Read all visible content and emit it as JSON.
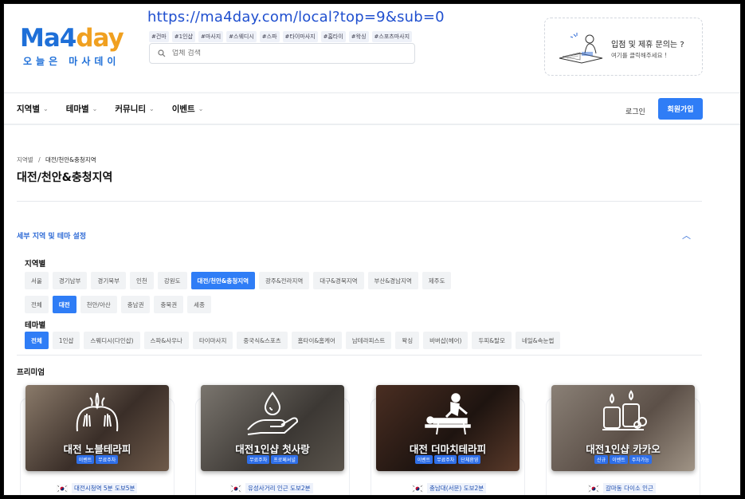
{
  "browser": {
    "url": "https://ma4day.com/local?top=9&sub=0"
  },
  "logo": {
    "main_part1": "Ma4",
    "main_part2": "day",
    "sub": "오늘은 마사데이"
  },
  "header": {
    "tags": [
      "#건마",
      "#1인샵",
      "#마사지",
      "#스웨디시",
      "#스파",
      "#타이마사지",
      "#홈타이",
      "#왁싱",
      "#스포츠마사지"
    ],
    "search_placeholder": "업체 검색"
  },
  "ad": {
    "title": "입점 및 제휴 문의는 ?",
    "subtitle": "여기를 클릭해주세요 !"
  },
  "nav": {
    "items": [
      "지역별",
      "테마별",
      "커뮤니티",
      "이벤트"
    ],
    "login": "로그인",
    "signup": "회원가입"
  },
  "breadcrumb": {
    "root": "지역별",
    "separator": "/",
    "current": "대전/천안&충청지역"
  },
  "page_title": "대전/천안&충청지역",
  "filters": {
    "section_title": "세부 지역 및 테마 설정",
    "region_label": "지역별",
    "regions": [
      "서울",
      "경기남부",
      "경기북부",
      "인천",
      "강원도",
      "대전/천안&충청지역",
      "광주&전라지역",
      "대구&경북지역",
      "부산&경남지역",
      "제주도"
    ],
    "region_selected": "대전/천안&충청지역",
    "subregions": [
      "전체",
      "대전",
      "천안/아산",
      "충남권",
      "충북권",
      "세종"
    ],
    "subregion_selected": "대전",
    "theme_label": "테마별",
    "themes": [
      "전체",
      "1인샵",
      "스웨디시(다인샵)",
      "스파&사우나",
      "타이마사지",
      "중국식&스포츠",
      "홈타이&홈케어",
      "남테라피스트",
      "왁싱",
      "바버샵(헤어)",
      "두피&탈모",
      "네일&속눈썹"
    ],
    "theme_selected": "전체"
  },
  "premium": {
    "label": "프리미엄",
    "cards": [
      {
        "name": "대전 노블테라피",
        "badges": [
          "이벤트",
          "무료주차"
        ],
        "location": "대전시청역 5분 도보5분",
        "icon": "hands-massage-icon"
      },
      {
        "name": "대전1인샵 첫사랑",
        "badges": [
          "무료주차",
          "프로페셔널"
        ],
        "location": "유성사거리 인근 도보2분",
        "icon": "hand-drop-icon"
      },
      {
        "name": "대전 더마치테라피",
        "badges": [
          "이벤트",
          "무료주차",
          "단체환영"
        ],
        "location": "충남대(서문) 도보2분",
        "icon": "massage-table-icon"
      },
      {
        "name": "대전1인샵 카카오",
        "badges": [
          "신규",
          "이벤트",
          "주차가능"
        ],
        "location": "갈마동 다이소 인근",
        "icon": "candles-icon"
      }
    ]
  }
}
